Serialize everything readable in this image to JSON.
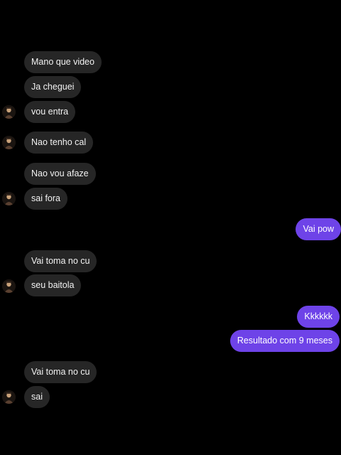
{
  "conversation": {
    "messages": [
      {
        "text": "Mano que video",
        "sender": "them"
      },
      {
        "text": "Ja cheguei",
        "sender": "them"
      },
      {
        "text": "vou entra",
        "sender": "them"
      },
      {
        "text": "Nao tenho cal",
        "sender": "them"
      },
      {
        "text": "Nao vou afaze",
        "sender": "them"
      },
      {
        "text": "sai fora",
        "sender": "them"
      },
      {
        "text": "Vai pow",
        "sender": "me"
      },
      {
        "text": "Vai toma no cu",
        "sender": "them"
      },
      {
        "text": "seu baitola",
        "sender": "them"
      },
      {
        "text": "Kkkkkk",
        "sender": "me"
      },
      {
        "text": "Resultado com 9 meses",
        "sender": "me"
      },
      {
        "text": "Vai toma no cu",
        "sender": "them"
      },
      {
        "text": "sai",
        "sender": "them"
      }
    ]
  },
  "colors": {
    "background": "#000000",
    "incoming_bubble": "#262626",
    "outgoing_bubble": "#6e43e8"
  },
  "icons": {
    "contact_avatar": "avatar-icon"
  }
}
